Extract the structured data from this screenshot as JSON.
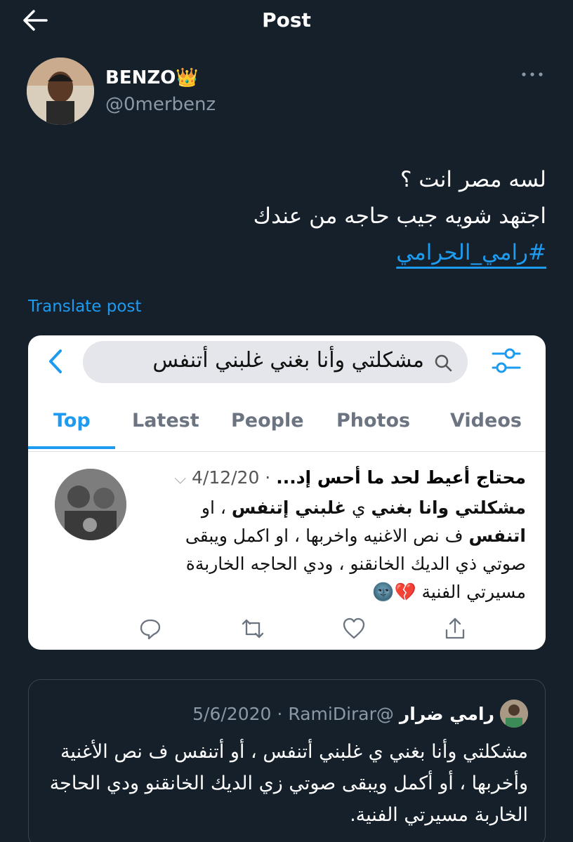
{
  "header": {
    "title": "Post"
  },
  "author": {
    "display_name": "BENZO👑",
    "handle": "@0merbenz"
  },
  "tweet": {
    "line1": "لسه مصر انت ؟",
    "line2": "اجتهد شويه جيب حاجه من عندك",
    "hashtag": "#رامي_الحرامي"
  },
  "translate_label": "Translate post",
  "screenshot": {
    "search_query": "مشكلتي وأنا بغني غلبني أتنفس",
    "tabs": [
      "Top",
      "Latest",
      "People",
      "Photos",
      "Videos"
    ],
    "active_tab": "Top",
    "post_name": "محتاج أعيط لحد ما أحس إد...",
    "post_date": "4/12/20",
    "body": {
      "s1_bold": "مشكلتي وانا بغني",
      "s2": " ي ",
      "s3_bold": "غلبني إتنفس",
      "s4": " ، او ",
      "s5_bold": "اتنفس",
      "s6": " ف نص الاغنيه واخربها ، او اكمل ويبقى صوتي ذي الديك الخانقنو ، ودي الحاجه الخاربةة مسيرتي الفنية 💔🌚"
    }
  },
  "quote": {
    "name": "رامي ضرار",
    "handle": "@RamiDirar",
    "separator": "·",
    "date": "5/6/2020",
    "body": "مشكلتي وأنا بغني ي غلبني أتنفس ، أو أتنفس ف نص الأغنية وأخربها ، أو أكمل ويبقى صوتي زي الديك الخانقنو ودي الحاجة الخاربة مسيرتي الفنية."
  },
  "colors": {
    "background": "#15202b",
    "accent": "#1d9bf0",
    "muted": "#8b98a5"
  }
}
